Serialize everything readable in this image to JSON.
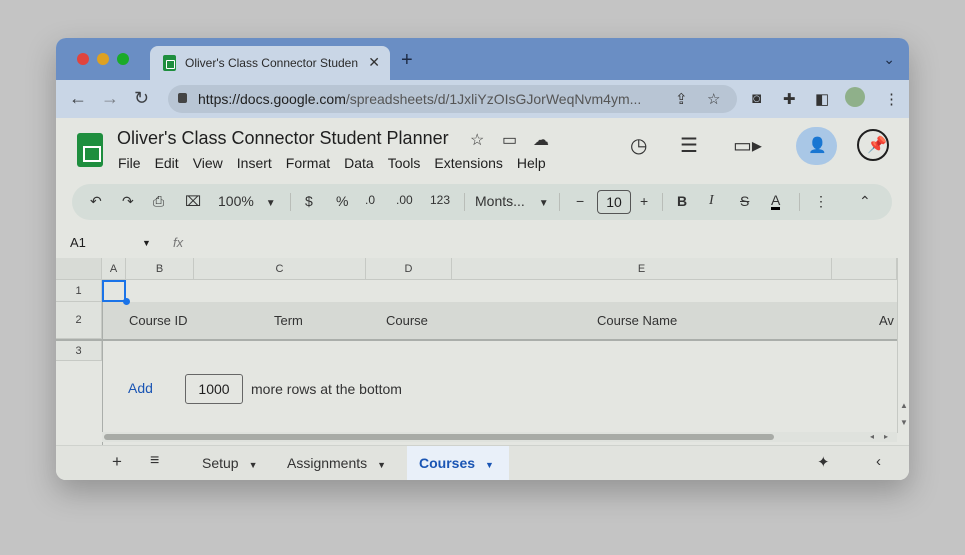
{
  "browser": {
    "tab_title": "Oliver's Class Connector Studen",
    "tab_close": "✕",
    "new_tab": "+",
    "url_host": "https://docs.google.com",
    "url_path": "/spreadsheets/d/1JxliYzOIsGJorWeqNvm4ym..."
  },
  "doc": {
    "title": "Oliver's Class Connector Student Planner",
    "menu": [
      "File",
      "Edit",
      "View",
      "Insert",
      "Format",
      "Data",
      "Tools",
      "Extensions",
      "Help"
    ]
  },
  "toolbar": {
    "zoom": "100%",
    "currency": "$",
    "percent": "%",
    "dec_decrease": ".0",
    "dec_increase": ".00",
    "number_format": "123",
    "font": "Monts...",
    "font_size": "10",
    "bold": "B",
    "italic": "I",
    "text_color": "A"
  },
  "formula_bar": {
    "name_box": "A1",
    "fx": "fx"
  },
  "grid": {
    "columns": [
      "A",
      "B",
      "C",
      "D",
      "E"
    ],
    "rows": [
      "1",
      "2",
      "3"
    ],
    "row2": [
      "Course ID",
      "Term",
      "Course",
      "Course Name",
      "Av"
    ],
    "add_label": "Add",
    "add_count": "1000",
    "add_suffix": "more rows at the bottom"
  },
  "sheets": {
    "tabs": [
      "Setup",
      "Assignments",
      "Courses"
    ],
    "active": "Courses"
  },
  "colors": {
    "accent": "#1a73e8",
    "sheets_green": "#1e8e3e"
  }
}
